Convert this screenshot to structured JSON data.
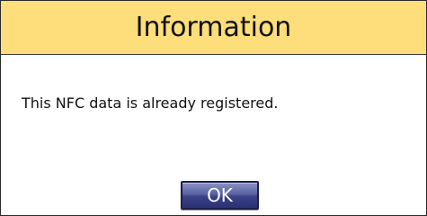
{
  "dialog": {
    "title": "Information",
    "message": "This NFC data is already registered.",
    "ok_label": "OK"
  },
  "colors": {
    "title_bar": "#fdde7a",
    "button": "#3a4187"
  }
}
